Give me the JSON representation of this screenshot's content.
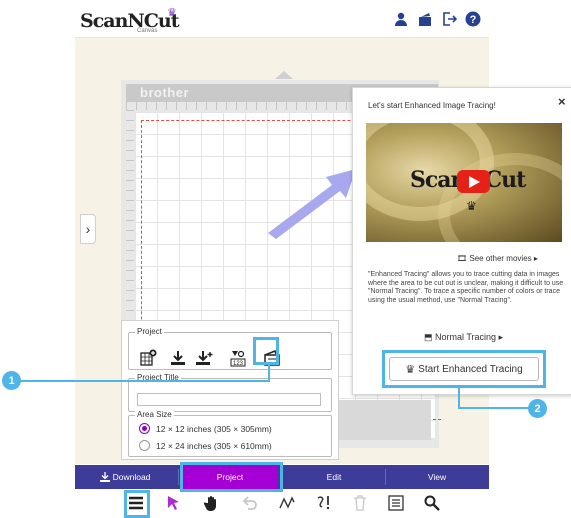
{
  "header": {
    "logo": "ScanNCut",
    "logo_sub": "Canvas",
    "icons": [
      "user-icon",
      "folder-icon",
      "logout-icon",
      "help-icon"
    ]
  },
  "mat": {
    "brand": "brother"
  },
  "popup": {
    "title": "Let's start Enhanced Image Tracing!",
    "close": "×",
    "video_logo": "ScanNCut",
    "see_other_movies": "See other movies ▸",
    "description": "\"Enhanced Tracing\" allows you to trace cutting data in images where the area to be cut out is unclear, making it difficult to use \"Normal Tracing\". To trace a specific number of colors or trace using the usual method, use \"Normal Tracing\".",
    "normal_tracing": "Normal Tracing ▸",
    "start_button": "Start Enhanced Tracing"
  },
  "project_panel": {
    "project_legend": "Project",
    "icons": [
      "new-project-icon",
      "download-icon",
      "download-plus-icon",
      "number-image-icon",
      "image-trace-icon"
    ],
    "title_legend": "Project Title",
    "title_value": "",
    "area_legend": "Area Size",
    "area_options": [
      {
        "label": "12 × 12 inches (305 × 305mm)",
        "selected": true
      },
      {
        "label": "12 × 24 inches (305 × 610mm)",
        "selected": false
      }
    ]
  },
  "tabs": {
    "download": "Download",
    "project": "Project",
    "edit": "Edit",
    "view": "View"
  },
  "toolbar": [
    "menu-icon",
    "select-arrow-icon",
    "hand-icon",
    "undo-icon",
    "line-tool-icon",
    "text-tool-icon",
    "trash-icon",
    "list-icon",
    "zoom-icon"
  ],
  "callouts": {
    "one": "1",
    "two": "2"
  },
  "colors": {
    "accent_purple": "#a400d6",
    "tab_bar": "#3d3c98",
    "highlight": "#4fb4e6",
    "cut_line": "#e24b4b"
  }
}
